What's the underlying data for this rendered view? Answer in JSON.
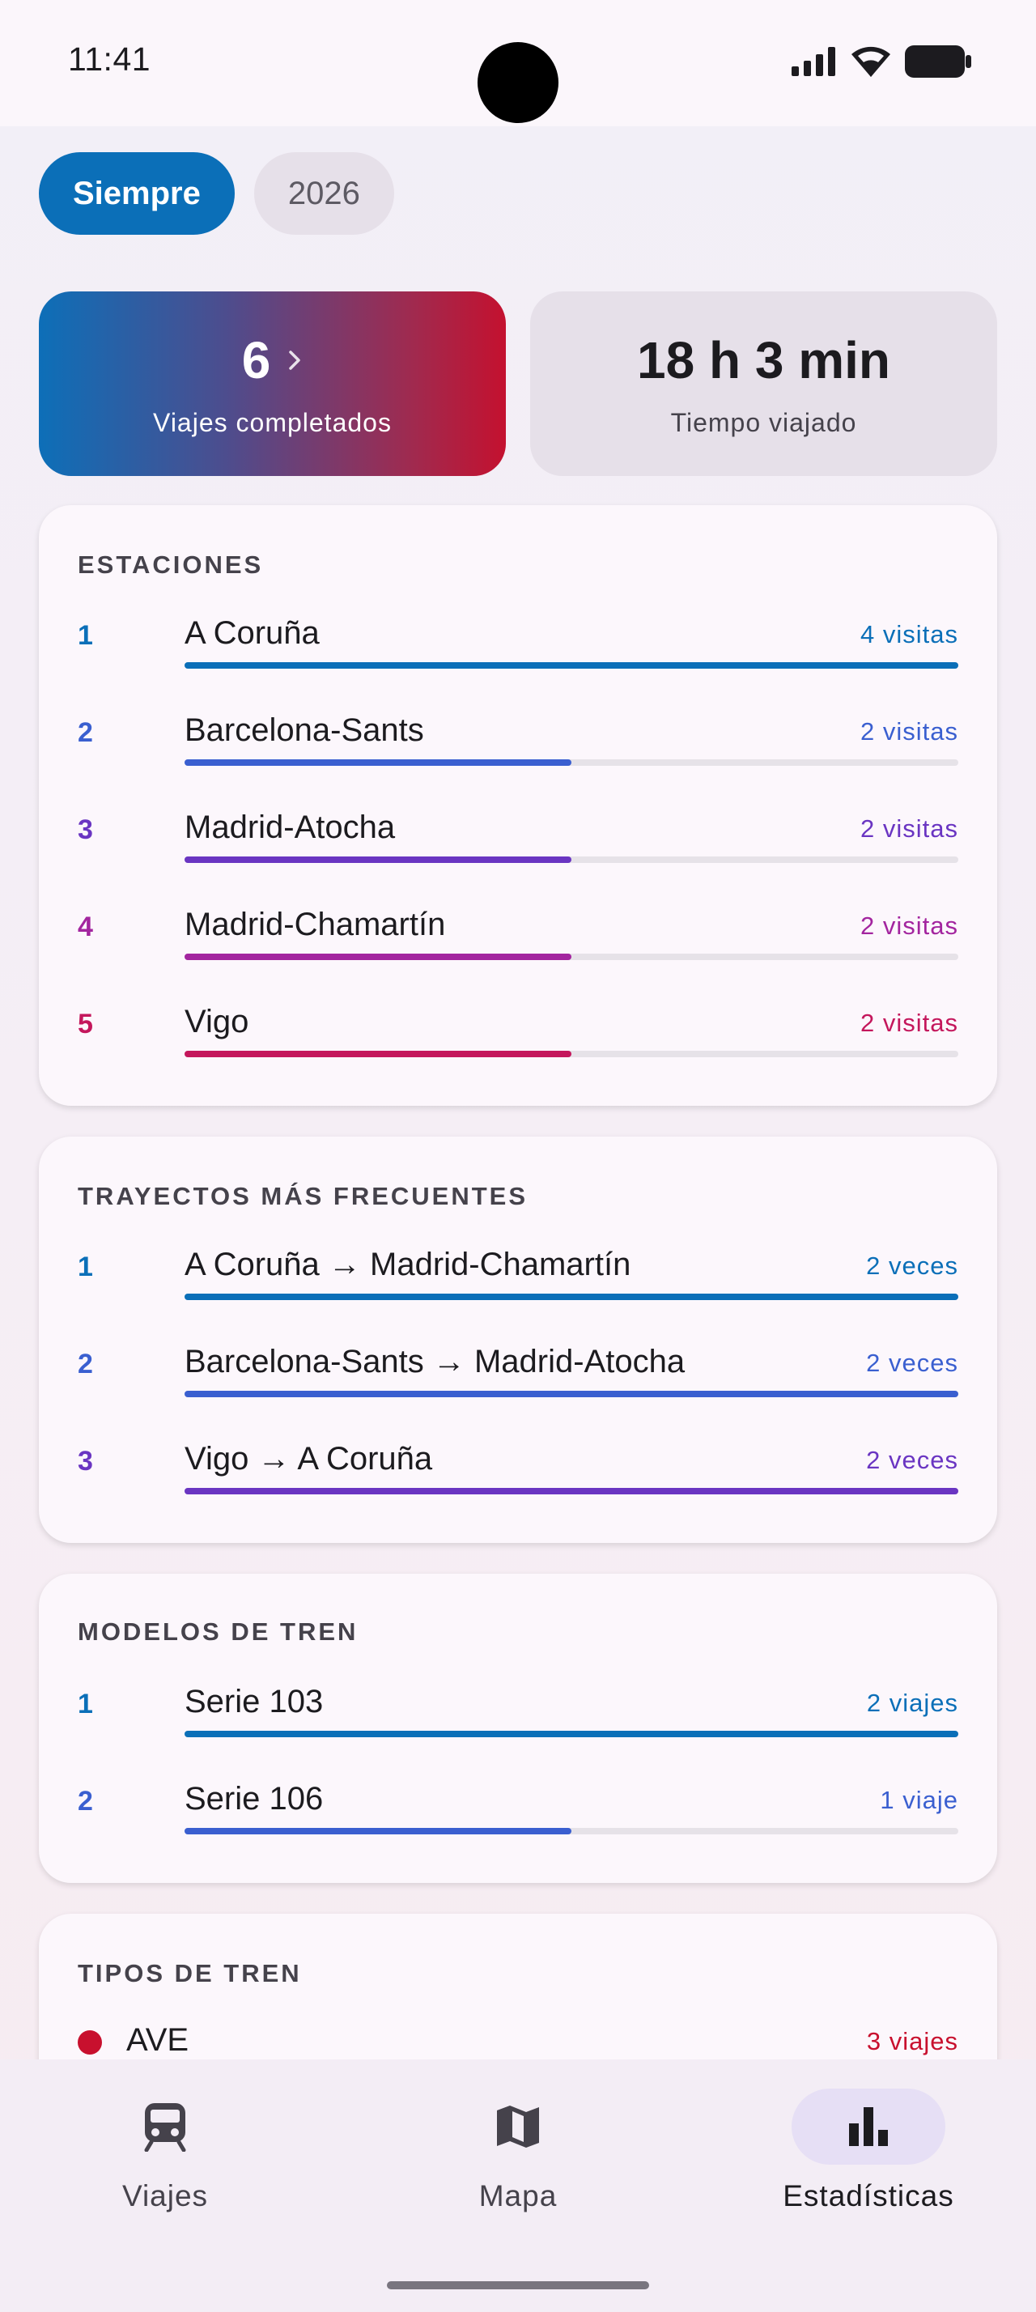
{
  "status_bar": {
    "time": "11:41"
  },
  "filters": {
    "active": "Siempre",
    "inactive": "2026"
  },
  "summary": {
    "trips_value": "6",
    "trips_label": "Viajes completados",
    "time_value": "18 h 3 min",
    "time_label": "Tiempo viajado"
  },
  "stations": {
    "title": "ESTACIONES",
    "items": [
      {
        "rank": "1",
        "name": "A Coruña",
        "count": "4 visitas",
        "fraction": 1.0,
        "color": "#0b6fb8"
      },
      {
        "rank": "2",
        "name": "Barcelona-Sants",
        "count": "2 visitas",
        "fraction": 0.5,
        "color": "#3a5fd0"
      },
      {
        "rank": "3",
        "name": "Madrid-Atocha",
        "count": "2 visitas",
        "fraction": 0.5,
        "color": "#6a35c2"
      },
      {
        "rank": "4",
        "name": "Madrid-Chamartín",
        "count": "2 visitas",
        "fraction": 0.5,
        "color": "#a3259f"
      },
      {
        "rank": "5",
        "name": "Vigo",
        "count": "2 visitas",
        "fraction": 0.5,
        "color": "#c4175c"
      }
    ]
  },
  "routes": {
    "title": "TRAYECTOS MÁS FRECUENTES",
    "items": [
      {
        "rank": "1",
        "name": "A Coruña → Madrid-Chamartín",
        "count": "2 veces",
        "fraction": 1.0,
        "color": "#0b6fb8"
      },
      {
        "rank": "2",
        "name": "Barcelona-Sants → Madrid-Atocha",
        "count": "2 veces",
        "fraction": 1.0,
        "color": "#3a5fd0"
      },
      {
        "rank": "3",
        "name": "Vigo → A Coruña",
        "count": "2 veces",
        "fraction": 1.0,
        "color": "#6a35c2"
      }
    ]
  },
  "models": {
    "title": "MODELOS DE TREN",
    "items": [
      {
        "rank": "1",
        "name": "Serie 103",
        "count": "2 viajes",
        "fraction": 1.0,
        "color": "#0b6fb8"
      },
      {
        "rank": "2",
        "name": "Serie 106",
        "count": "1 viaje",
        "fraction": 0.5,
        "color": "#3a5fd0"
      }
    ]
  },
  "types": {
    "title": "TIPOS DE TREN",
    "items": [
      {
        "name": "AVE",
        "count": "3 viajes",
        "color": "#c8102e"
      }
    ]
  },
  "nav": {
    "items": [
      {
        "label": "Viajes",
        "icon": "train-icon"
      },
      {
        "label": "Mapa",
        "icon": "map-icon"
      },
      {
        "label": "Estadísticas",
        "icon": "bar-chart-icon",
        "active": true
      }
    ]
  }
}
